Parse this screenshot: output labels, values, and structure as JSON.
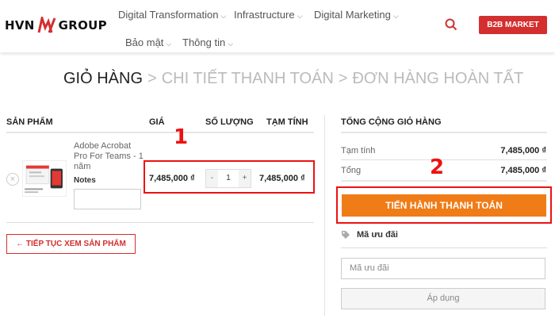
{
  "header": {
    "logo_left": "HVN",
    "logo_right": "GROUP",
    "nav": [
      {
        "label": "Digital Transformation"
      },
      {
        "label": "Infrastructure"
      },
      {
        "label": "Digital Marketing"
      },
      {
        "label": "Bảo mật"
      },
      {
        "label": "Thông tin"
      }
    ],
    "b2b_label": "B2B MARKET",
    "accent_color": "#d32f2f"
  },
  "breadcrumb": {
    "steps": [
      "GIỎ HÀNG",
      "CHI TIẾT THANH TOÁN",
      "ĐƠN HÀNG HOÀN TẤT"
    ],
    "separator": ">"
  },
  "cart": {
    "columns": [
      "SẢN PHẨM",
      "GIÁ",
      "SỐ LƯỢNG",
      "TẠM TÍNH"
    ],
    "remove_symbol": "×",
    "item": {
      "name": "Adobe Acrobat Pro For Teams - 1 năm",
      "notes_label": "Notes",
      "price": "7,485,000 ₫",
      "qty_minus": "-",
      "quantity": "1",
      "qty_plus": "+",
      "subtotal": "7,485,000 ₫"
    },
    "continue_label": "← TIẾP TỤC XEM SẢN PHẨM"
  },
  "totals": {
    "title": "TỔNG CỘNG GIỎ HÀNG",
    "rows": [
      {
        "label": "Tạm tính",
        "value": "7,485,000 ₫"
      },
      {
        "label": "Tổng",
        "value": "7,485,000 ₫"
      }
    ],
    "checkout_label": "TIẾN HÀNH THANH TOÁN",
    "checkout_color": "#f07c17",
    "coupon_heading": "Mã ưu đãi",
    "coupon_placeholder": "Mã ưu đãi",
    "apply_label": "Áp dụng"
  },
  "annotations": {
    "marker_1": "1",
    "marker_2": "2",
    "color": "#e11111"
  }
}
